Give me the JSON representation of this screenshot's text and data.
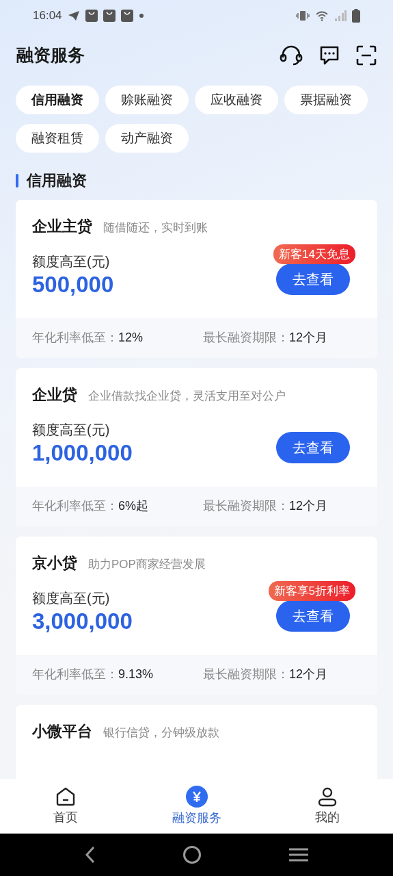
{
  "status_bar": {
    "time": "16:04"
  },
  "header": {
    "title": "融资服务"
  },
  "chips": [
    {
      "label": "信用融资",
      "selected": true
    },
    {
      "label": "赊账融资",
      "selected": false
    },
    {
      "label": "应收融资",
      "selected": false
    },
    {
      "label": "票据融资",
      "selected": false
    },
    {
      "label": "融资租赁",
      "selected": false
    },
    {
      "label": "动产融资",
      "selected": false
    }
  ],
  "section_title": "信用融资",
  "products": [
    {
      "name": "企业主贷",
      "slogan": "随借随还，实时到账",
      "limit_label": "额度高至(元)",
      "amount": "500,000",
      "badge": "新客14天免息",
      "button": "去查看",
      "rate_label": "年化利率低至：",
      "rate_value": "12%",
      "term_label": "最长融资期限：",
      "term_value": "12个月"
    },
    {
      "name": "企业贷",
      "slogan": "企业借款找企业贷，灵活支用至对公户",
      "limit_label": "额度高至(元)",
      "amount": "1,000,000",
      "button": "去查看",
      "rate_label": "年化利率低至：",
      "rate_value": "6%起",
      "term_label": "最长融资期限：",
      "term_value": "12个月"
    },
    {
      "name": "京小贷",
      "slogan": "助力POP商家经营发展",
      "limit_label": "额度高至(元)",
      "amount": "3,000,000",
      "badge": "新客享5折利率",
      "button": "去查看",
      "rate_label": "年化利率低至：",
      "rate_value": "9.13%",
      "term_label": "最长融资期限：",
      "term_value": "12个月"
    },
    {
      "name": "小微平台",
      "slogan": "银行信贷，分钟级放款"
    }
  ],
  "bottom_nav": [
    {
      "label": "首页",
      "kind": "home",
      "selected": false
    },
    {
      "label": "融资服务",
      "kind": "finance",
      "selected": true
    },
    {
      "label": "我的",
      "kind": "profile",
      "selected": false
    }
  ]
}
